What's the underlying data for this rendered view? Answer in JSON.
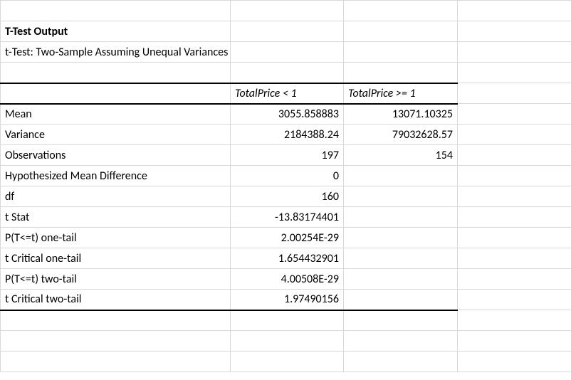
{
  "title": "T-Test Output",
  "subtitle": "t-Test: Two-Sample Assuming Unequal Variances",
  "columns": {
    "group1": "TotalPrice < 1",
    "group2": "TotalPrice >= 1"
  },
  "rows": {
    "mean": {
      "label": "Mean",
      "g1": "3055.858883",
      "g2": "13071.10325"
    },
    "variance": {
      "label": "Variance",
      "g1": "2184388.24",
      "g2": "79032628.57"
    },
    "observations": {
      "label": "Observations",
      "g1": "197",
      "g2": "154"
    },
    "hypMeanDiff": {
      "label": "Hypothesized Mean Difference",
      "g1": "0",
      "g2": ""
    },
    "df": {
      "label": "df",
      "g1": "160",
      "g2": ""
    },
    "tStat": {
      "label": "t Stat",
      "g1": "-13.83174401",
      "g2": ""
    },
    "pOneTail": {
      "label": "P(T<=t) one-tail",
      "g1": "2.00254E-29",
      "g2": ""
    },
    "tCritOne": {
      "label": "t Critical one-tail",
      "g1": "1.654432901",
      "g2": ""
    },
    "pTwoTail": {
      "label": "P(T<=t) two-tail",
      "g1": "4.00508E-29",
      "g2": ""
    },
    "tCritTwo": {
      "label": "t Critical two-tail",
      "g1": "1.97490156",
      "g2": ""
    }
  },
  "chart_data": {
    "type": "table",
    "title": "t-Test: Two-Sample Assuming Unequal Variances",
    "columns": [
      "",
      "TotalPrice < 1",
      "TotalPrice >= 1"
    ],
    "rows": [
      [
        "Mean",
        3055.858883,
        13071.10325
      ],
      [
        "Variance",
        2184388.24,
        79032628.57
      ],
      [
        "Observations",
        197,
        154
      ],
      [
        "Hypothesized Mean Difference",
        0,
        null
      ],
      [
        "df",
        160,
        null
      ],
      [
        "t Stat",
        -13.83174401,
        null
      ],
      [
        "P(T<=t) one-tail",
        2.00254e-29,
        null
      ],
      [
        "t Critical one-tail",
        1.654432901,
        null
      ],
      [
        "P(T<=t) two-tail",
        4.00508e-29,
        null
      ],
      [
        "t Critical two-tail",
        1.97490156,
        null
      ]
    ]
  }
}
